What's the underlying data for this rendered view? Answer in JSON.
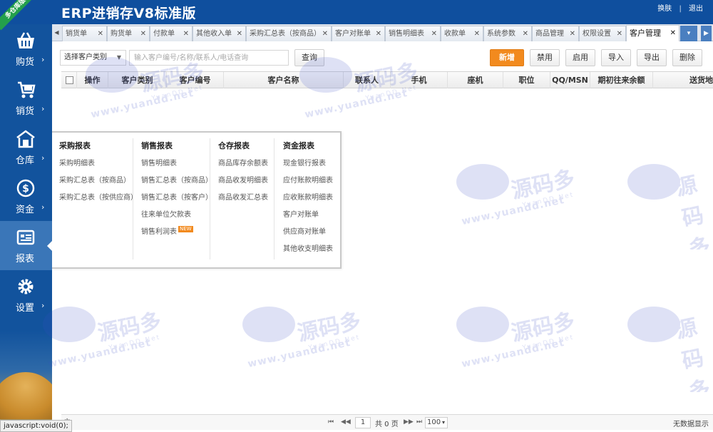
{
  "header": {
    "title": "ERP进销存V8标准版",
    "ribbon": "多仓库版",
    "links": {
      "change_skin": "换肤",
      "logout": "退出"
    }
  },
  "sidebar": {
    "items": [
      {
        "label": "购货",
        "icon": "basket-icon"
      },
      {
        "label": "销货",
        "icon": "cart-icon"
      },
      {
        "label": "仓库",
        "icon": "warehouse-icon"
      },
      {
        "label": "资金",
        "icon": "dollar-icon"
      },
      {
        "label": "报表",
        "icon": "report-icon"
      },
      {
        "label": "设置",
        "icon": "gear-icon"
      }
    ],
    "active_index": 4,
    "arrow": "›"
  },
  "tabs": [
    {
      "label": "销货单"
    },
    {
      "label": "购货单"
    },
    {
      "label": "付款单"
    },
    {
      "label": "其他收入单"
    },
    {
      "label": "采购汇总表（按商品）"
    },
    {
      "label": "客户对账单"
    },
    {
      "label": "销售明细表"
    },
    {
      "label": "收款单"
    },
    {
      "label": "系统参数"
    },
    {
      "label": "商品管理"
    },
    {
      "label": "权限设置"
    },
    {
      "label": "客户管理",
      "active": true
    }
  ],
  "toolbar": {
    "category_select": "选择客户类别",
    "search_placeholder": "输入客户编号/名称/联系人/电话查询",
    "search_button": "查询",
    "new_button": "新增",
    "disable_button": "禁用",
    "enable_button": "启用",
    "import_button": "导入",
    "export_button": "导出",
    "delete_button": "删除"
  },
  "grid": {
    "columns": [
      "操作",
      "客户类别",
      "客户编号",
      "客户名称",
      "联系人",
      "手机",
      "座机",
      "职位",
      "QQ/MSN",
      "期初往来余额",
      "送货地"
    ],
    "rows": []
  },
  "report_menu": {
    "columns": [
      {
        "title": "采购报表",
        "items": [
          "采购明细表",
          "采购汇总表（按商品）",
          "采购汇总表（按供应商）"
        ]
      },
      {
        "title": "销售报表",
        "items": [
          "销售明细表",
          "销售汇总表（按商品）",
          "销售汇总表（按客户）",
          "往来单位欠款表",
          "销售利润表"
        ],
        "new_badge_item": 4,
        "new_badge": "NEW"
      },
      {
        "title": "仓存报表",
        "items": [
          "商品库存余额表",
          "商品收发明细表",
          "商品收发汇总表"
        ]
      },
      {
        "title": "资金报表",
        "items": [
          "现金银行报表",
          "应付账款明细表",
          "应收账款明细表",
          "客户对账单",
          "供应商对账单",
          "其他收支明细表"
        ]
      }
    ]
  },
  "footer": {
    "page": "1",
    "page_info": "共 0 页",
    "page_size": "100",
    "no_data": "无数据显示"
  },
  "watermark": {
    "brand": "源码多",
    "url": "www.yuandd.net",
    "sub": "YuanDD.Net"
  },
  "status_bar": "javascript:void(0);",
  "colors": {
    "header_bg": "#0f4f9e",
    "sidebar_bg": "#12539d",
    "accent_orange": "#f28a1e",
    "ribbon_green": "#24a04b"
  }
}
